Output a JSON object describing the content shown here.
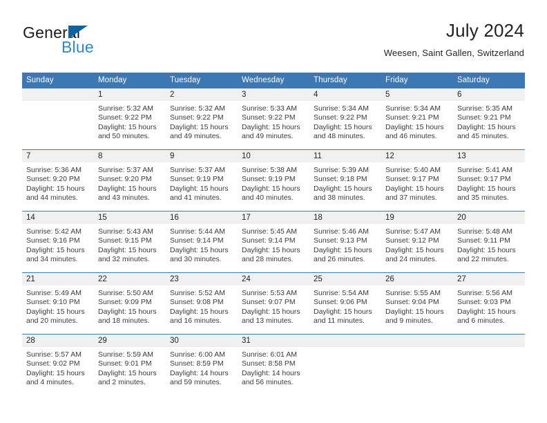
{
  "brand": {
    "name_dark": "General",
    "name_blue": "Blue",
    "accent_blue": "#2f87d4",
    "triangle_blue": "#11619e"
  },
  "header": {
    "month_title": "July 2024",
    "location": "Weesen, Saint Gallen, Switzerland"
  },
  "calendar": {
    "header_bg": "#3b78b4",
    "daynum_bg": "#f0f0f0",
    "weekday_headers": [
      "Sunday",
      "Monday",
      "Tuesday",
      "Wednesday",
      "Thursday",
      "Friday",
      "Saturday"
    ],
    "weeks": [
      [
        {
          "day": "",
          "sunrise": "",
          "sunset": "",
          "daylight_line1": "",
          "daylight_line2": ""
        },
        {
          "day": "1",
          "sunrise": "Sunrise: 5:32 AM",
          "sunset": "Sunset: 9:22 PM",
          "daylight_line1": "Daylight: 15 hours",
          "daylight_line2": "and 50 minutes."
        },
        {
          "day": "2",
          "sunrise": "Sunrise: 5:32 AM",
          "sunset": "Sunset: 9:22 PM",
          "daylight_line1": "Daylight: 15 hours",
          "daylight_line2": "and 49 minutes."
        },
        {
          "day": "3",
          "sunrise": "Sunrise: 5:33 AM",
          "sunset": "Sunset: 9:22 PM",
          "daylight_line1": "Daylight: 15 hours",
          "daylight_line2": "and 49 minutes."
        },
        {
          "day": "4",
          "sunrise": "Sunrise: 5:34 AM",
          "sunset": "Sunset: 9:22 PM",
          "daylight_line1": "Daylight: 15 hours",
          "daylight_line2": "and 48 minutes."
        },
        {
          "day": "5",
          "sunrise": "Sunrise: 5:34 AM",
          "sunset": "Sunset: 9:21 PM",
          "daylight_line1": "Daylight: 15 hours",
          "daylight_line2": "and 46 minutes."
        },
        {
          "day": "6",
          "sunrise": "Sunrise: 5:35 AM",
          "sunset": "Sunset: 9:21 PM",
          "daylight_line1": "Daylight: 15 hours",
          "daylight_line2": "and 45 minutes."
        }
      ],
      [
        {
          "day": "7",
          "sunrise": "Sunrise: 5:36 AM",
          "sunset": "Sunset: 9:20 PM",
          "daylight_line1": "Daylight: 15 hours",
          "daylight_line2": "and 44 minutes."
        },
        {
          "day": "8",
          "sunrise": "Sunrise: 5:37 AM",
          "sunset": "Sunset: 9:20 PM",
          "daylight_line1": "Daylight: 15 hours",
          "daylight_line2": "and 43 minutes."
        },
        {
          "day": "9",
          "sunrise": "Sunrise: 5:37 AM",
          "sunset": "Sunset: 9:19 PM",
          "daylight_line1": "Daylight: 15 hours",
          "daylight_line2": "and 41 minutes."
        },
        {
          "day": "10",
          "sunrise": "Sunrise: 5:38 AM",
          "sunset": "Sunset: 9:19 PM",
          "daylight_line1": "Daylight: 15 hours",
          "daylight_line2": "and 40 minutes."
        },
        {
          "day": "11",
          "sunrise": "Sunrise: 5:39 AM",
          "sunset": "Sunset: 9:18 PM",
          "daylight_line1": "Daylight: 15 hours",
          "daylight_line2": "and 38 minutes."
        },
        {
          "day": "12",
          "sunrise": "Sunrise: 5:40 AM",
          "sunset": "Sunset: 9:17 PM",
          "daylight_line1": "Daylight: 15 hours",
          "daylight_line2": "and 37 minutes."
        },
        {
          "day": "13",
          "sunrise": "Sunrise: 5:41 AM",
          "sunset": "Sunset: 9:17 PM",
          "daylight_line1": "Daylight: 15 hours",
          "daylight_line2": "and 35 minutes."
        }
      ],
      [
        {
          "day": "14",
          "sunrise": "Sunrise: 5:42 AM",
          "sunset": "Sunset: 9:16 PM",
          "daylight_line1": "Daylight: 15 hours",
          "daylight_line2": "and 34 minutes."
        },
        {
          "day": "15",
          "sunrise": "Sunrise: 5:43 AM",
          "sunset": "Sunset: 9:15 PM",
          "daylight_line1": "Daylight: 15 hours",
          "daylight_line2": "and 32 minutes."
        },
        {
          "day": "16",
          "sunrise": "Sunrise: 5:44 AM",
          "sunset": "Sunset: 9:14 PM",
          "daylight_line1": "Daylight: 15 hours",
          "daylight_line2": "and 30 minutes."
        },
        {
          "day": "17",
          "sunrise": "Sunrise: 5:45 AM",
          "sunset": "Sunset: 9:14 PM",
          "daylight_line1": "Daylight: 15 hours",
          "daylight_line2": "and 28 minutes."
        },
        {
          "day": "18",
          "sunrise": "Sunrise: 5:46 AM",
          "sunset": "Sunset: 9:13 PM",
          "daylight_line1": "Daylight: 15 hours",
          "daylight_line2": "and 26 minutes."
        },
        {
          "day": "19",
          "sunrise": "Sunrise: 5:47 AM",
          "sunset": "Sunset: 9:12 PM",
          "daylight_line1": "Daylight: 15 hours",
          "daylight_line2": "and 24 minutes."
        },
        {
          "day": "20",
          "sunrise": "Sunrise: 5:48 AM",
          "sunset": "Sunset: 9:11 PM",
          "daylight_line1": "Daylight: 15 hours",
          "daylight_line2": "and 22 minutes."
        }
      ],
      [
        {
          "day": "21",
          "sunrise": "Sunrise: 5:49 AM",
          "sunset": "Sunset: 9:10 PM",
          "daylight_line1": "Daylight: 15 hours",
          "daylight_line2": "and 20 minutes."
        },
        {
          "day": "22",
          "sunrise": "Sunrise: 5:50 AM",
          "sunset": "Sunset: 9:09 PM",
          "daylight_line1": "Daylight: 15 hours",
          "daylight_line2": "and 18 minutes."
        },
        {
          "day": "23",
          "sunrise": "Sunrise: 5:52 AM",
          "sunset": "Sunset: 9:08 PM",
          "daylight_line1": "Daylight: 15 hours",
          "daylight_line2": "and 16 minutes."
        },
        {
          "day": "24",
          "sunrise": "Sunrise: 5:53 AM",
          "sunset": "Sunset: 9:07 PM",
          "daylight_line1": "Daylight: 15 hours",
          "daylight_line2": "and 13 minutes."
        },
        {
          "day": "25",
          "sunrise": "Sunrise: 5:54 AM",
          "sunset": "Sunset: 9:06 PM",
          "daylight_line1": "Daylight: 15 hours",
          "daylight_line2": "and 11 minutes."
        },
        {
          "day": "26",
          "sunrise": "Sunrise: 5:55 AM",
          "sunset": "Sunset: 9:04 PM",
          "daylight_line1": "Daylight: 15 hours",
          "daylight_line2": "and 9 minutes."
        },
        {
          "day": "27",
          "sunrise": "Sunrise: 5:56 AM",
          "sunset": "Sunset: 9:03 PM",
          "daylight_line1": "Daylight: 15 hours",
          "daylight_line2": "and 6 minutes."
        }
      ],
      [
        {
          "day": "28",
          "sunrise": "Sunrise: 5:57 AM",
          "sunset": "Sunset: 9:02 PM",
          "daylight_line1": "Daylight: 15 hours",
          "daylight_line2": "and 4 minutes."
        },
        {
          "day": "29",
          "sunrise": "Sunrise: 5:59 AM",
          "sunset": "Sunset: 9:01 PM",
          "daylight_line1": "Daylight: 15 hours",
          "daylight_line2": "and 2 minutes."
        },
        {
          "day": "30",
          "sunrise": "Sunrise: 6:00 AM",
          "sunset": "Sunset: 8:59 PM",
          "daylight_line1": "Daylight: 14 hours",
          "daylight_line2": "and 59 minutes."
        },
        {
          "day": "31",
          "sunrise": "Sunrise: 6:01 AM",
          "sunset": "Sunset: 8:58 PM",
          "daylight_line1": "Daylight: 14 hours",
          "daylight_line2": "and 56 minutes."
        },
        {
          "day": "",
          "sunrise": "",
          "sunset": "",
          "daylight_line1": "",
          "daylight_line2": ""
        },
        {
          "day": "",
          "sunrise": "",
          "sunset": "",
          "daylight_line1": "",
          "daylight_line2": ""
        },
        {
          "day": "",
          "sunrise": "",
          "sunset": "",
          "daylight_line1": "",
          "daylight_line2": ""
        }
      ]
    ]
  }
}
